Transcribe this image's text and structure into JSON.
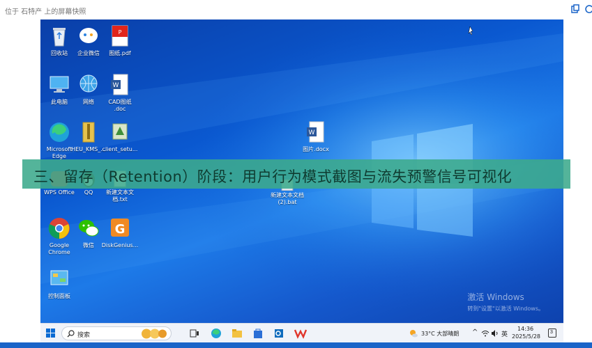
{
  "viewer": {
    "title": "位于 石特产 上的屏幕快照"
  },
  "desktop": {
    "icons": [
      {
        "label": "回收站",
        "icon": "recycle-bin-icon"
      },
      {
        "label": "企业微信",
        "icon": "wecom-icon"
      },
      {
        "label": "图纸.pdf",
        "icon": "pdf-file-icon"
      },
      {
        "label": "此电脑",
        "icon": "computer-icon"
      },
      {
        "label": "网络",
        "icon": "network-icon"
      },
      {
        "label": "CAD图纸",
        "label2": ".doc",
        "icon": "word-doc-icon"
      },
      {
        "label": "Microsoft",
        "label2": "Edge",
        "icon": "edge-icon"
      },
      {
        "label": "HEU_KMS_...",
        "icon": "archive-icon"
      },
      {
        "label": "client_setu...",
        "icon": "installer-icon"
      },
      {
        "label": "图片.docx",
        "icon": "word-doc-icon"
      },
      {
        "label": "WPS Office",
        "icon": "wps-icon"
      },
      {
        "label": "QQ",
        "icon": "qq-icon"
      },
      {
        "label": "新建文本文",
        "label2": "档.txt",
        "icon": "text-file-icon"
      },
      {
        "label": "新建文本文档",
        "label2": "(2).bat",
        "icon": "bat-file-icon"
      },
      {
        "label": "Google",
        "label2": "Chrome",
        "icon": "chrome-icon"
      },
      {
        "label": "微信",
        "icon": "wechat-icon"
      },
      {
        "label": "DiskGenius...",
        "icon": "diskgenius-icon"
      },
      {
        "label": "控制面板",
        "icon": "control-panel-icon"
      }
    ],
    "activation": {
      "line1": "激活 Windows",
      "line2": "转到\"设置\"以激活 Windows。"
    }
  },
  "taskbar": {
    "search_label": "搜索",
    "weather": "33°C  大部晴朗",
    "ime": "英",
    "time": "14:36",
    "date": "2025/5/28",
    "notification_count": "3"
  },
  "banner": {
    "text": "三、留存（Retention）阶段：用户行为模式截图与流失预警信号可视化"
  },
  "colors": {
    "banner_bg": "#3caa8c",
    "desktop_blue": "#0a58d0",
    "taskbar_bg": "#f0f3f9"
  }
}
